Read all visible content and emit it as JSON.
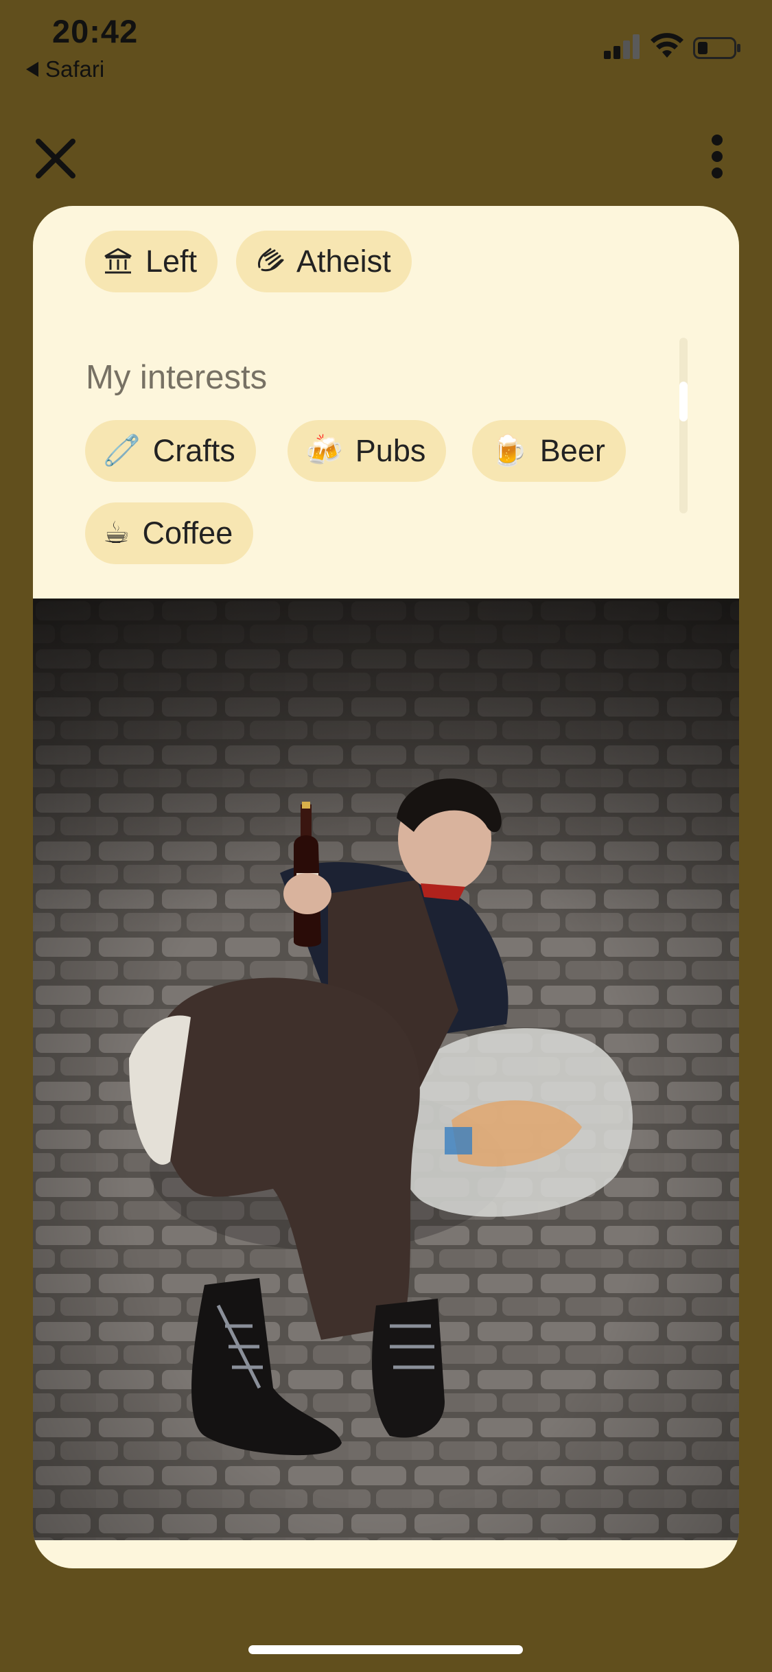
{
  "status_bar": {
    "time": "20:42",
    "back_app": "Safari"
  },
  "top_bar": {
    "close_icon": "close-icon",
    "more_icon": "more-vertical-icon"
  },
  "profile": {
    "tags": [
      {
        "label": "Left",
        "icon": "politics-icon"
      },
      {
        "label": "Atheist",
        "icon": "religion-icon"
      }
    ],
    "interests_title": "My interests",
    "interests": [
      {
        "label": "Crafts",
        "emoji": "🧷"
      },
      {
        "label": "Pubs",
        "emoji": "🍻"
      },
      {
        "label": "Beer",
        "emoji": "🍺"
      },
      {
        "label": "Coffee",
        "emoji": "☕"
      }
    ]
  },
  "colors": {
    "background": "#614f1d",
    "card": "#fdf6dc",
    "chip": "#f7e6b2"
  }
}
